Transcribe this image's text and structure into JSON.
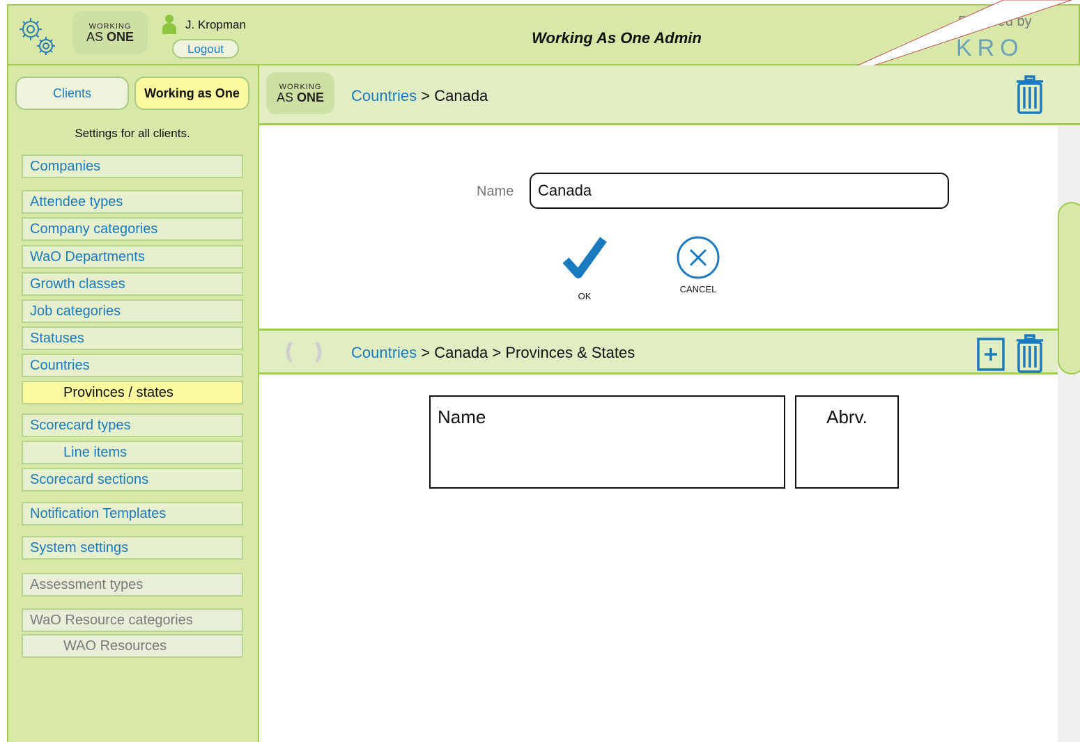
{
  "header": {
    "logo_top": "WORKING",
    "logo_bottom_as": "AS",
    "logo_bottom_one": "ONE",
    "user_name": "J. Kropman",
    "logout_label": "Logout",
    "app_title": "Working As One Admin",
    "powered_by": "Powered by",
    "powered_brand": "KRO"
  },
  "sidebar": {
    "tabs": [
      {
        "label": "Clients",
        "active": false
      },
      {
        "label": "Working as One",
        "active": true
      }
    ],
    "note": "Settings for all clients.",
    "items": [
      {
        "label": "Companies"
      },
      {
        "label": "Attendee types"
      },
      {
        "label": "Company categories"
      },
      {
        "label": "WaO Departments"
      },
      {
        "label": "Growth classes"
      },
      {
        "label": "Job categories"
      },
      {
        "label": "Statuses"
      },
      {
        "label": "Countries"
      },
      {
        "label": "Provinces / states",
        "active": true
      },
      {
        "label": "Scorecard types"
      },
      {
        "label": "Line items"
      },
      {
        "label": "Scorecard sections"
      },
      {
        "label": "Notification Templates"
      },
      {
        "label": "System settings"
      },
      {
        "label": "Assessment types",
        "disabled": true
      },
      {
        "label": "WaO Resource categories",
        "disabled": true
      },
      {
        "label": "WAO Resources",
        "disabled": true
      }
    ]
  },
  "panel1": {
    "breadcrumb_link": "Countries",
    "breadcrumb_rest": " > Canada",
    "name_label": "Name",
    "name_value": "Canada",
    "ok_label": "OK",
    "cancel_label": "CANCEL"
  },
  "panel2": {
    "breadcrumb_link": "Countries",
    "breadcrumb_rest": " > Canada > Provinces & States",
    "columns": [
      "Name",
      "Abrv."
    ]
  },
  "colors": {
    "header_bg": "#d7e8a8",
    "border_green": "#9fcd4a",
    "link_blue": "#1a7ac0",
    "icon_blue": "#1a7ac0",
    "active_yellow": "#fbfa9f"
  }
}
